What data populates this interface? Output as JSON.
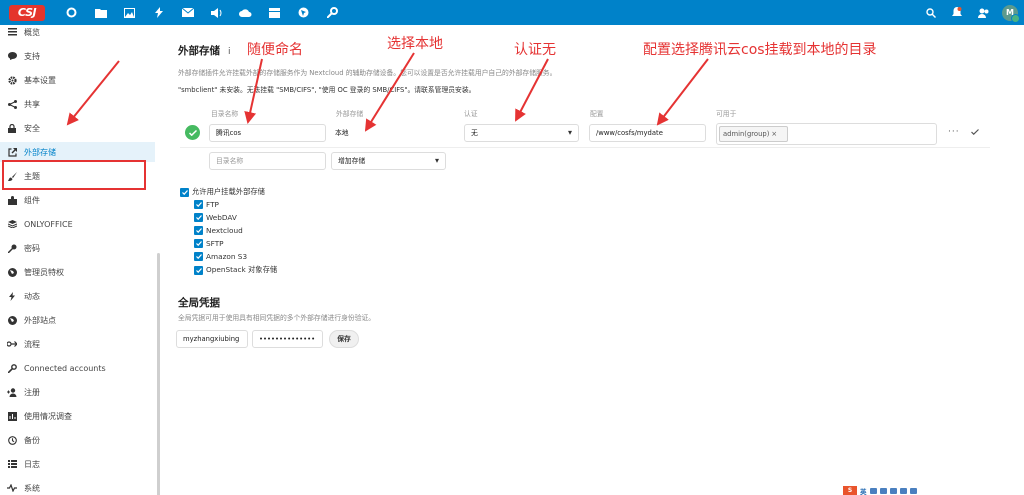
{
  "topbar": {
    "logo_text": "CSJ",
    "apps": [
      "dashboard-icon",
      "files-icon",
      "photos-icon",
      "activity-icon",
      "mail-icon",
      "audio-icon",
      "cloud-icon",
      "deck-icon",
      "maps-icon",
      "tools-icon"
    ],
    "right": [
      "search-icon",
      "notifications-icon",
      "contacts-icon"
    ],
    "avatar_initial": "M"
  },
  "sidebar": {
    "items": [
      {
        "label": "概览",
        "icon": "list-icon"
      },
      {
        "label": "支持",
        "icon": "chat-icon"
      },
      {
        "label": "基本设置",
        "icon": "gear-icon"
      },
      {
        "label": "共享",
        "icon": "share-icon"
      },
      {
        "label": "安全",
        "icon": "lock-icon"
      },
      {
        "label": "外部存储",
        "icon": "external-icon"
      },
      {
        "label": "主题",
        "icon": "brush-icon"
      },
      {
        "label": "组件",
        "icon": "puzzle-icon"
      },
      {
        "label": "ONLYOFFICE",
        "icon": "onlyoffice-icon"
      },
      {
        "label": "密码",
        "icon": "key-icon"
      },
      {
        "label": "管理员特权",
        "icon": "globe-icon"
      },
      {
        "label": "动态",
        "icon": "flash-icon"
      },
      {
        "label": "外部站点",
        "icon": "globe-icon"
      },
      {
        "label": "流程",
        "icon": "flow-icon"
      },
      {
        "label": "Connected accounts",
        "icon": "tools-icon"
      },
      {
        "label": "注册",
        "icon": "user-add-icon"
      },
      {
        "label": "使用情况调查",
        "icon": "chart-icon"
      },
      {
        "label": "备份",
        "icon": "history-icon"
      },
      {
        "label": "日志",
        "icon": "log-icon"
      },
      {
        "label": "系统",
        "icon": "pulse-icon"
      }
    ],
    "active_index": 5
  },
  "external_storage": {
    "title": "外部存储",
    "info": "i",
    "description": "外部存储插件允许挂载外部的存储服务作为 Nextcloud 的辅助存储设备。您可以设置是否允许挂载用户自己的外部存储服务。",
    "warning": "\"smbclient\" 未安装。无法挂载 \"SMB/CIFS\", \"使用 OC 登录的 SMB/CIFS\"。请联系管理员安装。",
    "columns": [
      "目录名称",
      "外部存储",
      "认证",
      "配置",
      "可用于"
    ],
    "row": {
      "folder_name": "腾讯cos",
      "backend": "本地",
      "auth": "无",
      "config": "/www/cosfs/mydate",
      "applicable_chip": "admin(group)",
      "chip_remove": "×",
      "more": "···"
    },
    "new_row": {
      "folder_placeholder": "目录名称",
      "add_storage": "增加存储"
    },
    "allow_user_mounting": "允许用户挂载外部存储",
    "backends": [
      "FTP",
      "WebDAV",
      "Nextcloud",
      "SFTP",
      "Amazon S3",
      "OpenStack 对象存储"
    ]
  },
  "global_credentials": {
    "title": "全局凭据",
    "description": "全局凭据可用于使用具有相同凭据的多个外部存储进行身份验证。",
    "username": "myzhangxiubing",
    "password": "••••••••••••••",
    "save_label": "保存"
  },
  "annotations": [
    "随便命名",
    "选择本地",
    "认证无",
    "配置选择腾讯云cos挂载到本地的目录"
  ],
  "bottom_widget": {
    "logo": "S",
    "text": "英"
  },
  "colors": {
    "brand": "#0082c9",
    "annotation": "#e53333",
    "ok": "#46ba61"
  }
}
